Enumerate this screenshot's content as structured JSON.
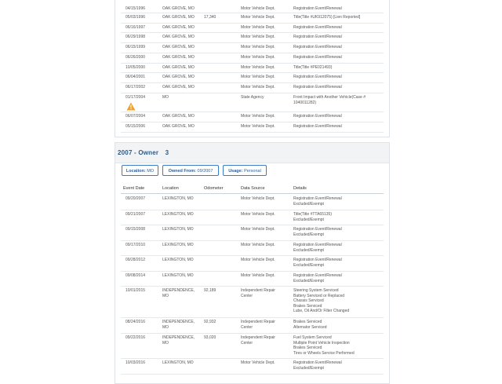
{
  "history1": {
    "rows": [
      {
        "date": "04/15/1996",
        "location": "OAK GROVE, MO",
        "odometer": "",
        "source": "Motor Vehicle Dept.",
        "details": [
          "Registration Event/Renewal"
        ]
      },
      {
        "date": "05/03/1996",
        "location": "OAK GROVE, MO",
        "odometer": "17,340",
        "source": "Motor Vehicle Dept.",
        "details": [
          "Title(Title #UK912075) [Lien Reported]"
        ]
      },
      {
        "date": "06/16/1997",
        "location": "OAK GROVE, MO",
        "odometer": "",
        "source": "Motor Vehicle Dept.",
        "details": [
          "Registration Event/Renewal"
        ]
      },
      {
        "date": "06/29/1998",
        "location": "OAK GROVE, MO",
        "odometer": "",
        "source": "Motor Vehicle Dept.",
        "details": [
          "Registration Event/Renewal"
        ]
      },
      {
        "date": "06/15/1999",
        "location": "OAK GROVE, MO",
        "odometer": "",
        "source": "Motor Vehicle Dept.",
        "details": [
          "Registration Event/Renewal"
        ]
      },
      {
        "date": "06/26/2000",
        "location": "OAK GROVE, MO",
        "odometer": "",
        "source": "Motor Vehicle Dept.",
        "details": [
          "Registration Event/Renewal"
        ]
      },
      {
        "date": "10/05/2000",
        "location": "OAK GROVE, MO",
        "odometer": "",
        "source": "Motor Vehicle Dept.",
        "details": [
          "Title(Title #PE021493)"
        ]
      },
      {
        "date": "06/04/2001",
        "location": "OAK GROVE, MO",
        "odometer": "",
        "source": "Motor Vehicle Dept.",
        "details": [
          "Registration Event/Renewal"
        ]
      },
      {
        "date": "06/17/2002",
        "location": "OAK GROVE, MO",
        "odometer": "",
        "source": "Motor Vehicle Dept.",
        "details": [
          "Registration Event/Renewal"
        ]
      },
      {
        "date": "01/17/2004",
        "location": "MO",
        "odometer": "",
        "source": "State Agency",
        "details": [
          "Front Impact with Another Vehicle(Case #",
          "1040011282)"
        ],
        "icon": "warning-triangle-icon"
      },
      {
        "date": "06/07/2004",
        "location": "OAK GROVE, MO",
        "odometer": "",
        "source": "Motor Vehicle Dept.",
        "details": [
          "Registration Event/Renewal"
        ]
      },
      {
        "date": "05/15/2006",
        "location": "OAK GROVE, MO",
        "odometer": "",
        "source": "Motor Vehicle Dept.",
        "details": [
          "Registration Event/Renewal"
        ]
      }
    ]
  },
  "owner3": {
    "year": "2007",
    "label": "- Owner",
    "number": "3",
    "chips": [
      {
        "label": "Location:",
        "value": "MO"
      },
      {
        "label": "Owned From:",
        "value": "09/2007"
      },
      {
        "label": "Usage:",
        "value": "Personal"
      }
    ],
    "headers": {
      "date": "Event Date",
      "location": "Location",
      "odometer": "Odometer",
      "source": "Data Source",
      "details": "Details"
    },
    "rows": [
      {
        "date": "09/20/2007",
        "location": [
          "LEXINGTON, MO"
        ],
        "odometer": "",
        "source": [
          "Motor Vehicle Dept."
        ],
        "details": [
          "Registration Event/Renewal",
          "Excluded/Exempt"
        ]
      },
      {
        "date": "09/21/2007",
        "location": [
          "LEXINGTON, MO"
        ],
        "odometer": "",
        "source": [
          "Motor Vehicle Dept."
        ],
        "details": [
          "Title(Title #TTA65135)",
          "Excluded/Exempt"
        ]
      },
      {
        "date": "09/15/2008",
        "location": [
          "LEXINGTON, MO"
        ],
        "odometer": "",
        "source": [
          "Motor Vehicle Dept."
        ],
        "details": [
          "Registration Event/Renewal",
          "Excluded/Exempt"
        ]
      },
      {
        "date": "09/17/2010",
        "location": [
          "LEXINGTON, MO"
        ],
        "odometer": "",
        "source": [
          "Motor Vehicle Dept."
        ],
        "details": [
          "Registration Event/Renewal",
          "Excluded/Exempt"
        ]
      },
      {
        "date": "09/28/2012",
        "location": [
          "LEXINGTON, MO"
        ],
        "odometer": "",
        "source": [
          "Motor Vehicle Dept."
        ],
        "details": [
          "Registration Event/Renewal",
          "Excluded/Exempt"
        ]
      },
      {
        "date": "09/08/2014",
        "location": [
          "LEXINGTON, MO"
        ],
        "odometer": "",
        "source": [
          "Motor Vehicle Dept."
        ],
        "details": [
          "Registration Event/Renewal",
          "Excluded/Exempt"
        ]
      },
      {
        "date": "10/01/2015",
        "location": [
          "INDEPENDENCE,",
          "MO"
        ],
        "odometer": "92,189",
        "source": [
          "Independent Repair",
          "Center"
        ],
        "details": [
          "Steering System Serviced",
          "Battery Serviced or Replaced",
          "Chassis Serviced",
          "Brakes Serviced",
          "Lube, Oil And/Or Filter Changed"
        ]
      },
      {
        "date": "08/24/2016",
        "location": [
          "INDEPENDENCE,",
          "MO"
        ],
        "odometer": "92,932",
        "source": [
          "Independent Repair",
          "Center"
        ],
        "details": [
          "Brakes Serviced",
          "Alternator Serviced"
        ]
      },
      {
        "date": "09/22/2016",
        "location": [
          "INDEPENDENCE,",
          "MO"
        ],
        "odometer": "93,020",
        "source": [
          "Independent Repair",
          "Center"
        ],
        "details": [
          "Fuel System Serviced",
          "Multiple Point Vehicle Inspection",
          "Brakes Serviced",
          "Tires or Wheels Service Performed"
        ]
      },
      {
        "date": "10/03/2016",
        "location": [
          "LEXINGTON, MO"
        ],
        "odometer": "",
        "source": [
          "Motor Vehicle Dept."
        ],
        "details": [
          "Registration Event/Renewal",
          "Excluded/Exempt"
        ]
      }
    ]
  },
  "colors": {
    "accent": "#2a5d8c",
    "chip_border": "#3b7cc4",
    "warning": "#f0a32a"
  }
}
